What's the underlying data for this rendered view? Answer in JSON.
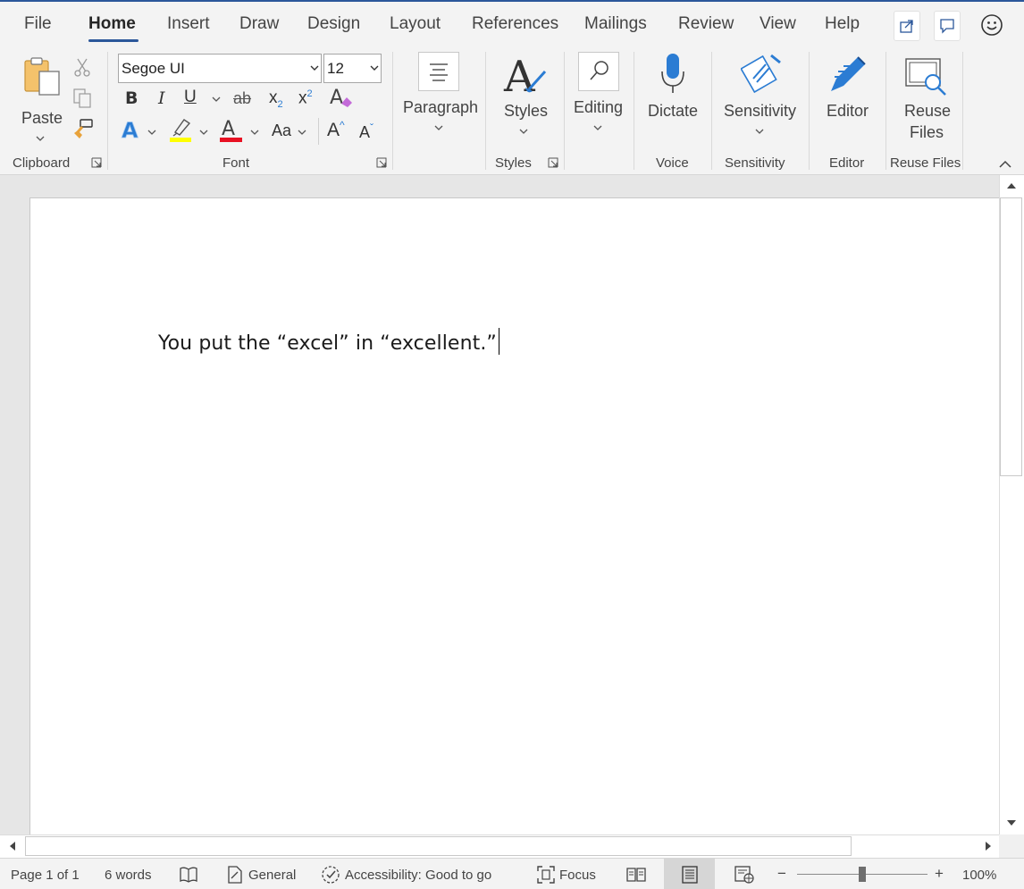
{
  "tabs": {
    "file": "File",
    "home": "Home",
    "insert": "Insert",
    "draw": "Draw",
    "design": "Design",
    "layout": "Layout",
    "references": "References",
    "mailings": "Mailings",
    "review": "Review",
    "view": "View",
    "help": "Help"
  },
  "clipboard": {
    "paste_label": "Paste",
    "group_label": "Clipboard"
  },
  "font": {
    "font_name": "Segoe UI",
    "font_size": "12",
    "bold": "B",
    "italic": "I",
    "underline": "U",
    "strikethrough": "ab",
    "subscript": "x",
    "superscript": "x",
    "change_case": "Aa",
    "grow_font": "A",
    "shrink_font": "A",
    "group_label": "Font",
    "highlight_color": "#ffff00",
    "font_color": "#e81123"
  },
  "paragraph": {
    "label": "Paragraph"
  },
  "styles": {
    "label": "Styles",
    "group_label": "Styles"
  },
  "editing": {
    "label": "Editing"
  },
  "voice": {
    "dictate_label": "Dictate",
    "group_label": "Voice"
  },
  "sensitivity": {
    "label": "Sensitivity",
    "group_label": "Sensitivity"
  },
  "editor": {
    "label": "Editor",
    "group_label": "Editor"
  },
  "reuse": {
    "label_line1": "Reuse",
    "label_line2": "Files",
    "group_label": "Reuse Files"
  },
  "document": {
    "text": "You put the “excel” in “excellent.”"
  },
  "status": {
    "page": "Page 1 of 1",
    "words": "6 words",
    "language": "General",
    "accessibility": "Accessibility: Good to go",
    "focus": "Focus",
    "zoom_out": "−",
    "zoom_in": "+",
    "zoom": "100%"
  },
  "colors": {
    "accent": "#2b579a",
    "ribbon_bg": "#f3f3f3",
    "icon_blue": "#2b7cd3"
  }
}
